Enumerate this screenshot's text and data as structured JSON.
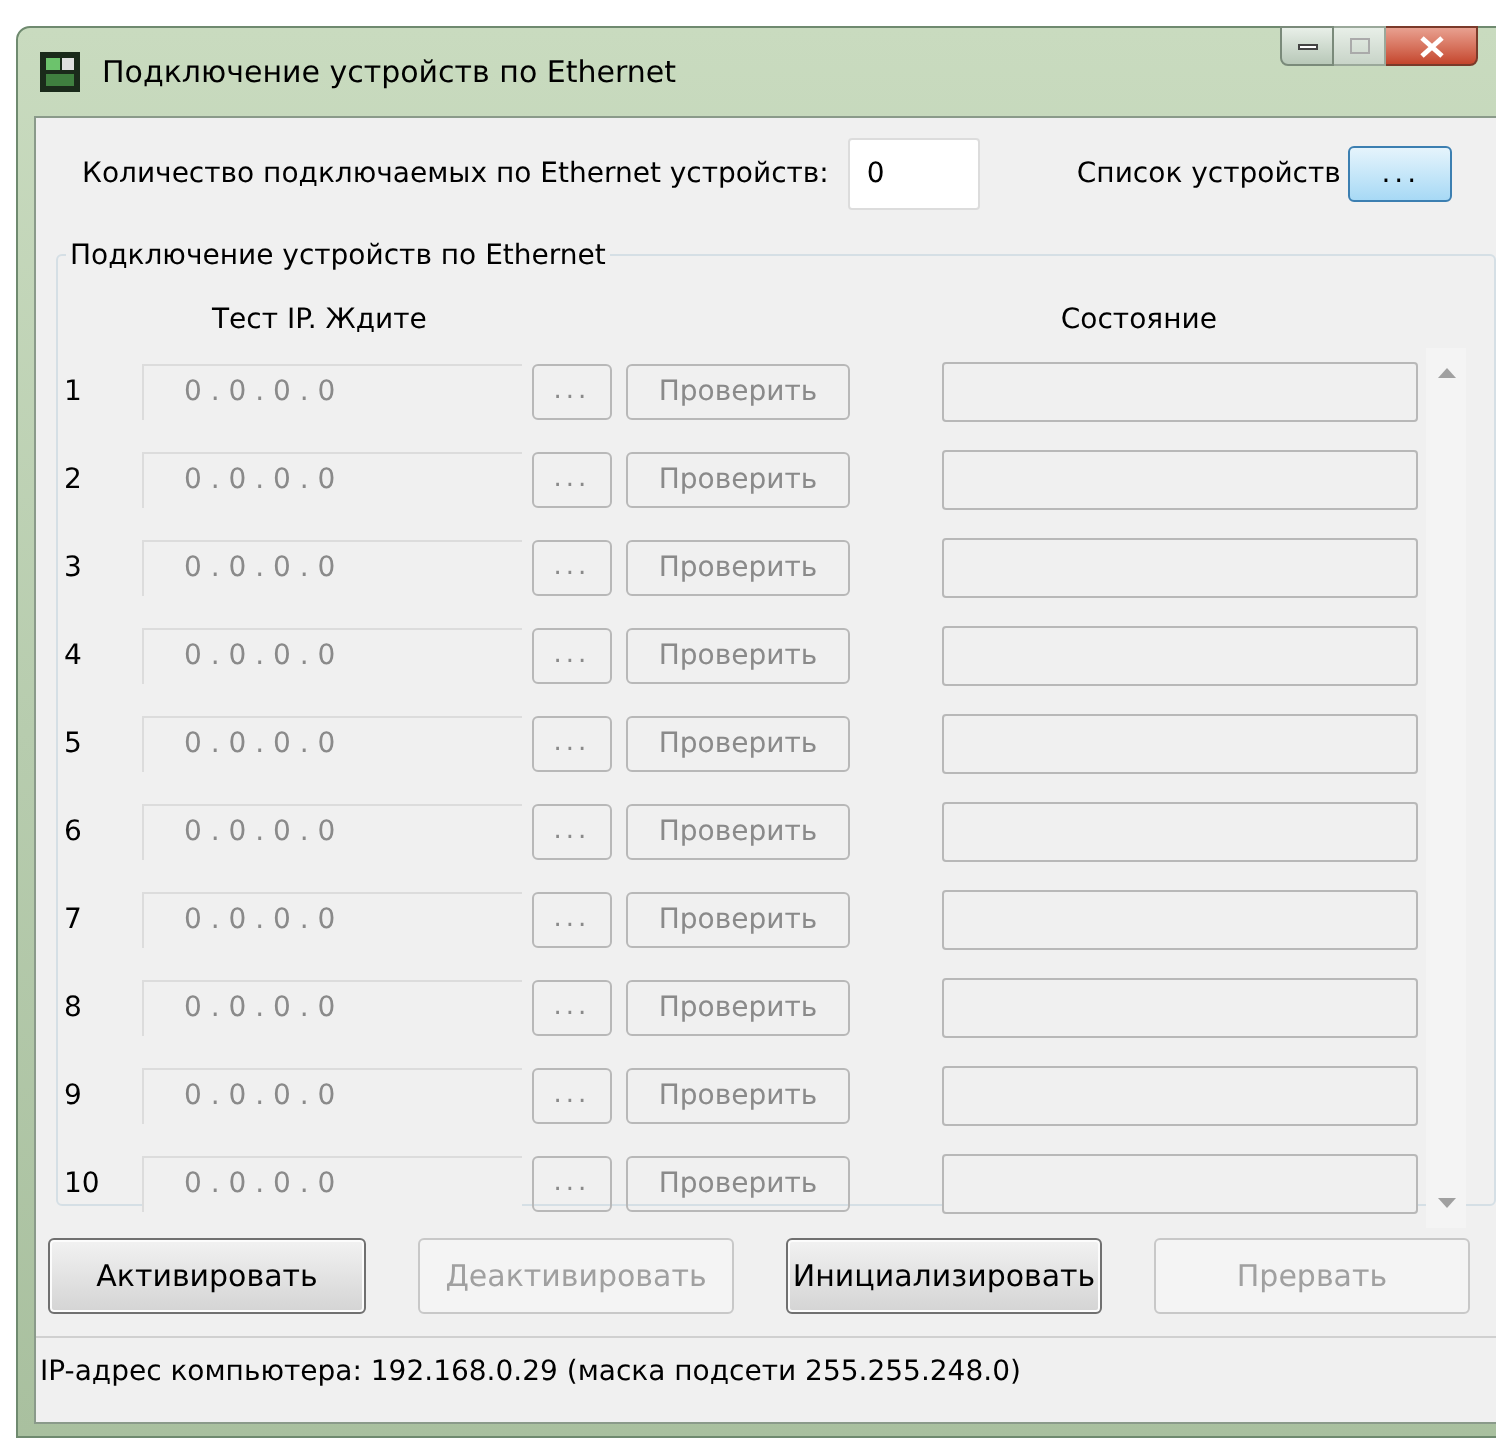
{
  "window": {
    "title": "Подключение устройств по Ethernet"
  },
  "count": {
    "label": "Количество подключаемых по Ethernet устройств:",
    "value": "0"
  },
  "device_list": {
    "label": "Список устройств",
    "button": "..."
  },
  "group": {
    "title": "Подключение устройств по Ethernet",
    "header_ip": "Тест IP. Ждите",
    "header_state": "Состояние",
    "rows": [
      {
        "number": "1",
        "ip": "0 . 0 . 0 . 0",
        "browse": "...",
        "check": "Проверить",
        "disabled": true
      },
      {
        "number": "2",
        "ip": "0 . 0 . 0 . 0",
        "browse": "...",
        "check": "Проверить",
        "disabled": true
      },
      {
        "number": "3",
        "ip": "0 . 0 . 0 . 0",
        "browse": "...",
        "check": "Проверить",
        "disabled": true
      },
      {
        "number": "4",
        "ip": "0 . 0 . 0 . 0",
        "browse": "...",
        "check": "Проверить",
        "disabled": true
      },
      {
        "number": "5",
        "ip": "0 . 0 . 0 . 0",
        "browse": "...",
        "check": "Проверить",
        "disabled": true
      },
      {
        "number": "6",
        "ip": "0 . 0 . 0 . 0",
        "browse": "...",
        "check": "Проверить",
        "disabled": true
      },
      {
        "number": "7",
        "ip": "0 . 0 . 0 . 0",
        "browse": "...",
        "check": "Проверить",
        "disabled": true
      },
      {
        "number": "8",
        "ip": "0 . 0 . 0 . 0",
        "browse": "...",
        "check": "Проверить",
        "disabled": true
      },
      {
        "number": "9",
        "ip": "0 . 0 . 0 . 0",
        "browse": "...",
        "check": "Проверить",
        "disabled": true
      },
      {
        "number": "10",
        "ip": "0 . 0 . 0 . 0",
        "browse": "...",
        "check": "Проверить",
        "disabled": true
      }
    ]
  },
  "buttons": [
    {
      "label": "Активировать",
      "disabled": false
    },
    {
      "label": "Деактивировать",
      "disabled": true
    },
    {
      "label": "Инициализировать",
      "disabled": false
    },
    {
      "label": "Прервать",
      "disabled": true
    }
  ],
  "status_bar": "IP-адрес компьютера: 192.168.0.29 (маска подсети 255.255.248.0)"
}
